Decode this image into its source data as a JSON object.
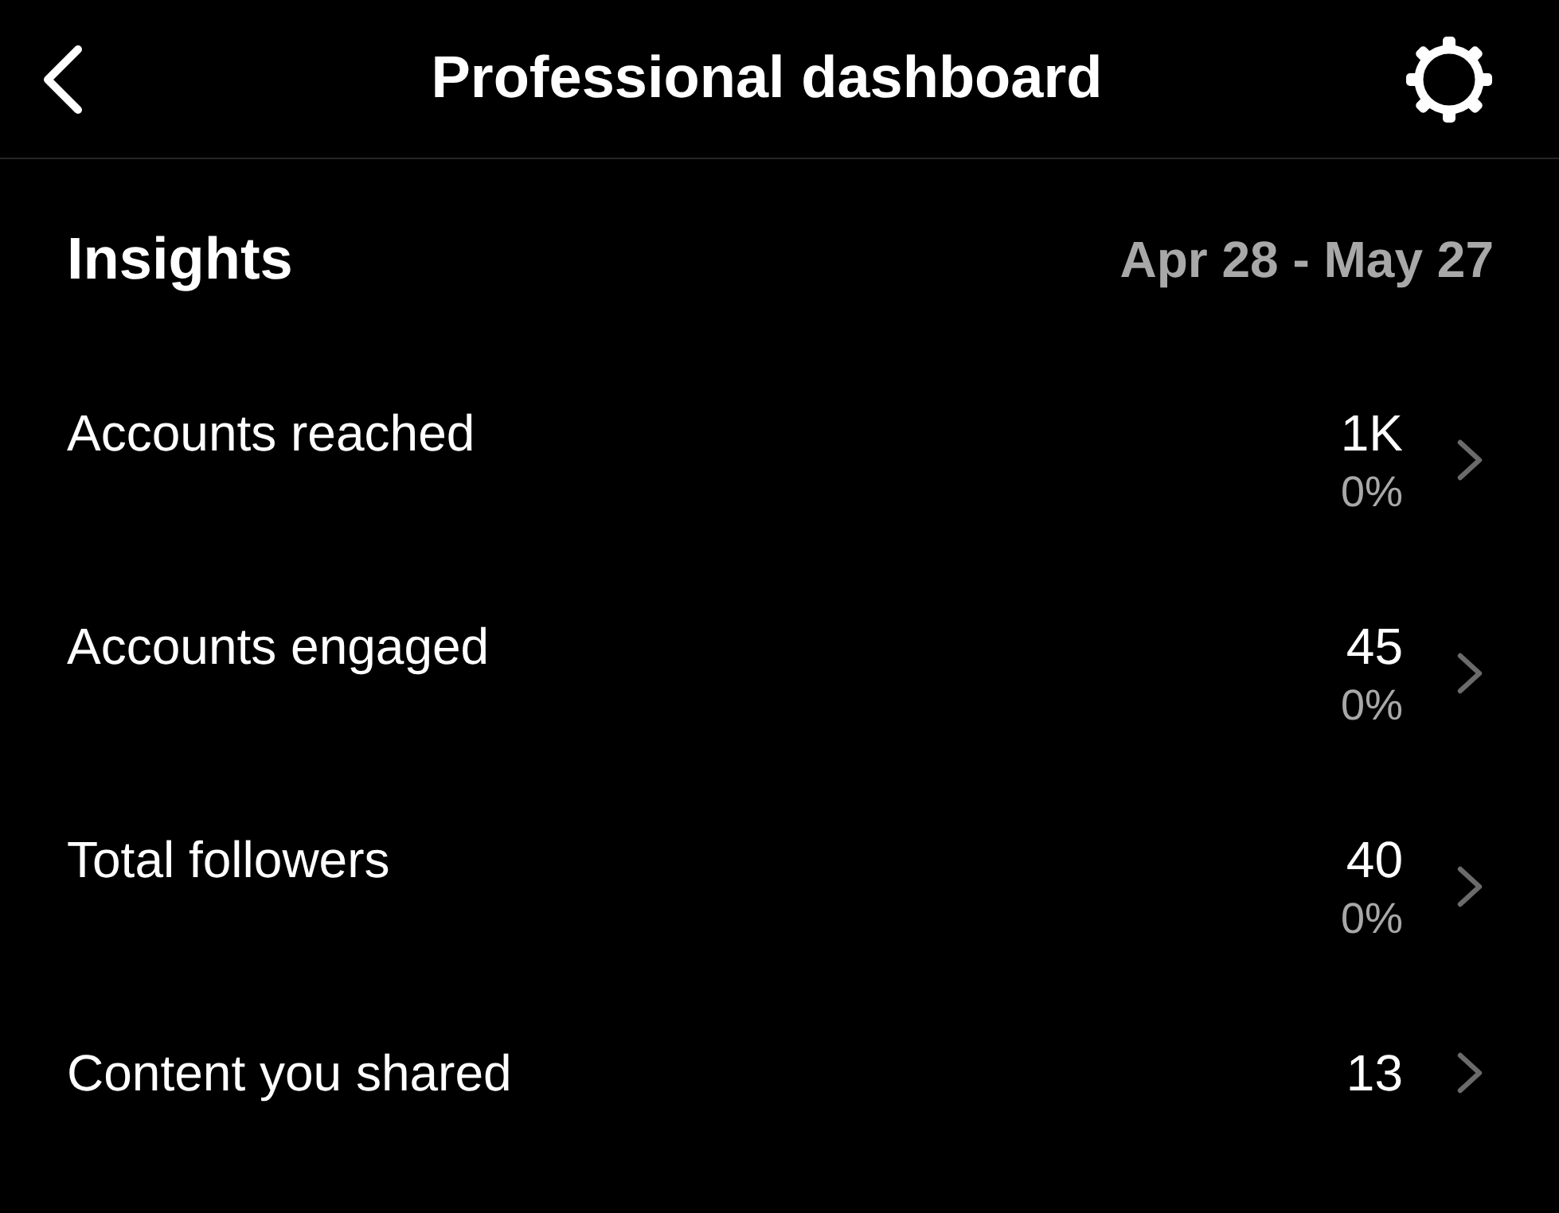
{
  "header": {
    "title": "Professional dashboard"
  },
  "insights": {
    "heading": "Insights",
    "date_range": "Apr 28 - May 27"
  },
  "rows": [
    {
      "label": "Accounts reached",
      "value": "1K",
      "change": "0%"
    },
    {
      "label": "Accounts engaged",
      "value": "45",
      "change": "0%"
    },
    {
      "label": "Total followers",
      "value": "40",
      "change": "0%"
    },
    {
      "label": "Content you shared",
      "value": "13"
    }
  ]
}
